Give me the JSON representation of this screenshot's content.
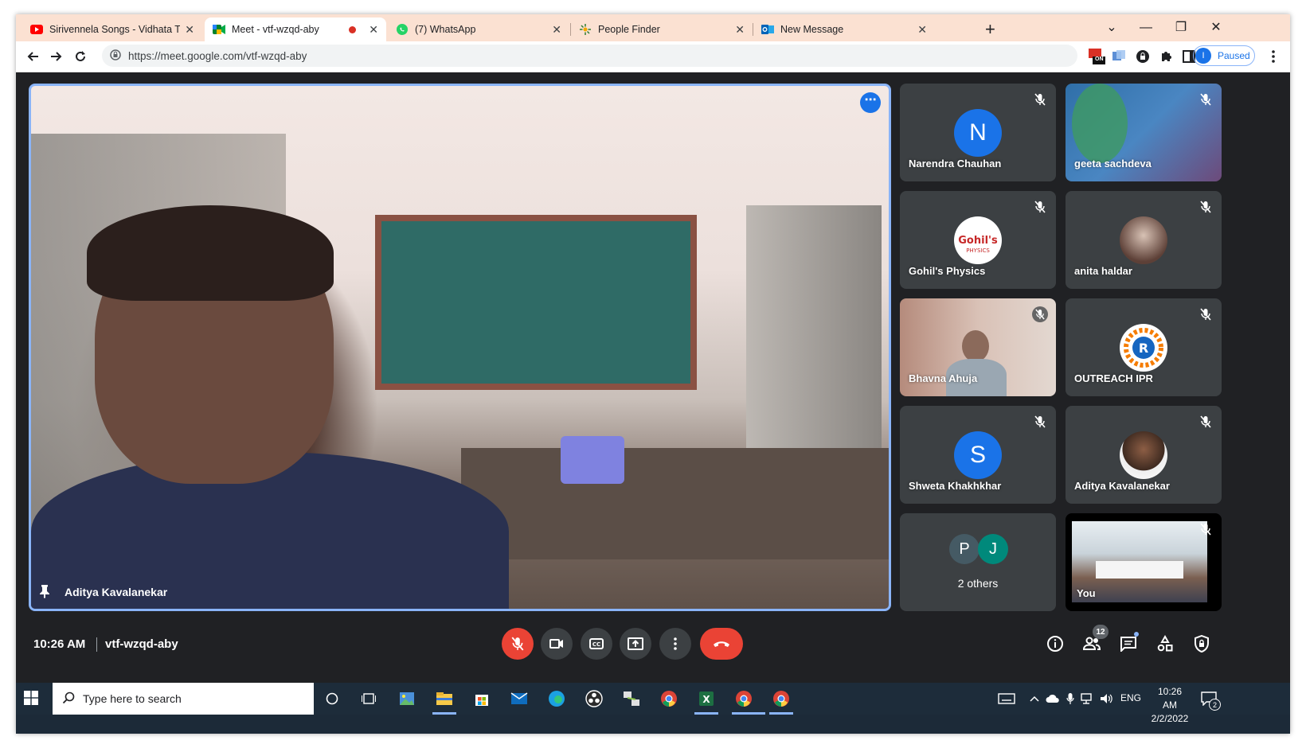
{
  "tabs": [
    {
      "title": "Sirivennela Songs - Vidhata Talap",
      "icon": "youtube-icon"
    },
    {
      "title": "Meet - vtf-wzqd-aby",
      "icon": "meet-icon",
      "recording": true
    },
    {
      "title": "(7) WhatsApp",
      "icon": "whatsapp-icon"
    },
    {
      "title": "People Finder",
      "icon": "people-finder-icon"
    },
    {
      "title": "New Message",
      "icon": "outlook-icon"
    }
  ],
  "address_bar": {
    "url": "https://meet.google.com/vtf-wzqd-aby"
  },
  "profile": {
    "initial": "I",
    "label": "Paused"
  },
  "extension_badge": "ON",
  "main_video": {
    "name": "Aditya Kavalanekar"
  },
  "participants": [
    {
      "name": "Narendra Chauhan",
      "initial": "N",
      "color": "#1a73e8"
    },
    {
      "name": "geeta sachdeva",
      "initial": ""
    },
    {
      "name": "Gohil's Physics",
      "initial": ""
    },
    {
      "name": "anita haldar",
      "initial": ""
    },
    {
      "name": "Bhavna Ahuja",
      "initial": ""
    },
    {
      "name": "OUTREACH IPR",
      "initial": ""
    },
    {
      "name": "Shweta Khakhkhar",
      "initial": "S",
      "color": "#1a73e8"
    },
    {
      "name": "Aditya Kavalanekar",
      "initial": ""
    },
    {
      "name": "2 others",
      "initials": [
        "P",
        "J"
      ],
      "colors": [
        "#455a64",
        "#00897b"
      ]
    },
    {
      "name": "You",
      "initial": ""
    }
  ],
  "meeting": {
    "time": "10:26 AM",
    "code": "vtf-wzqd-aby",
    "participant_count": "12"
  },
  "accent": {
    "blue": "#8ab4f8",
    "red": "#ea4335",
    "dark": "#202124"
  },
  "taskbar": {
    "search_placeholder": "Type here to search",
    "lang": "ENG",
    "time": "10:26 AM",
    "date": "2/2/2022",
    "notification_count": "2"
  }
}
